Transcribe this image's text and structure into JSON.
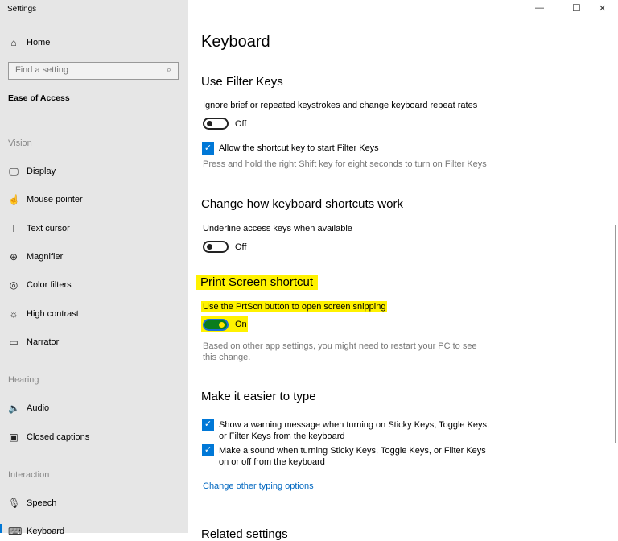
{
  "window": {
    "title": "Settings",
    "minimize": "—",
    "maximize": "☐",
    "close": "✕"
  },
  "sidebar": {
    "home": "Home",
    "search_placeholder": "Find a setting",
    "category": "Ease of Access",
    "groups": {
      "vision": "Vision",
      "hearing": "Hearing",
      "interaction": "Interaction"
    },
    "items": [
      {
        "label": "Display",
        "icon": "🖵"
      },
      {
        "label": "Mouse pointer",
        "icon": "☝"
      },
      {
        "label": "Text cursor",
        "icon": "I"
      },
      {
        "label": "Magnifier",
        "icon": "⊕"
      },
      {
        "label": "Color filters",
        "icon": "◎"
      },
      {
        "label": "High contrast",
        "icon": "☼"
      },
      {
        "label": "Narrator",
        "icon": "▭"
      },
      {
        "label": "Audio",
        "icon": "🔈"
      },
      {
        "label": "Closed captions",
        "icon": "▣"
      },
      {
        "label": "Speech",
        "icon": "🎙"
      },
      {
        "label": "Keyboard",
        "icon": "⌨"
      }
    ]
  },
  "main": {
    "title": "Keyboard",
    "filter_keys": {
      "heading": "Use Filter Keys",
      "desc": "Ignore brief or repeated keystrokes and change keyboard repeat rates",
      "toggle": "Off",
      "checkbox": "Allow the shortcut key to start Filter Keys",
      "hint": "Press and hold the right Shift key for eight seconds to turn on Filter Keys"
    },
    "shortcuts": {
      "heading": "Change how keyboard shortcuts work",
      "desc": "Underline access keys when available",
      "toggle": "Off"
    },
    "print_screen": {
      "heading": "Print Screen shortcut",
      "desc": "Use the PrtScn button to open screen snipping",
      "toggle": "On",
      "note1": "Based on other app settings, you might need to restart your PC to see",
      "note2": "this change."
    },
    "typing": {
      "heading": "Make it easier to type",
      "cb1a": "Show a warning message when turning on Sticky Keys, Toggle Keys,",
      "cb1b": "or Filter Keys from the keyboard",
      "cb2a": "Make a sound when turning Sticky Keys, Toggle Keys, or Filter Keys",
      "cb2b": "on or off from the keyboard",
      "link": "Change other typing options"
    },
    "related": "Related settings"
  }
}
